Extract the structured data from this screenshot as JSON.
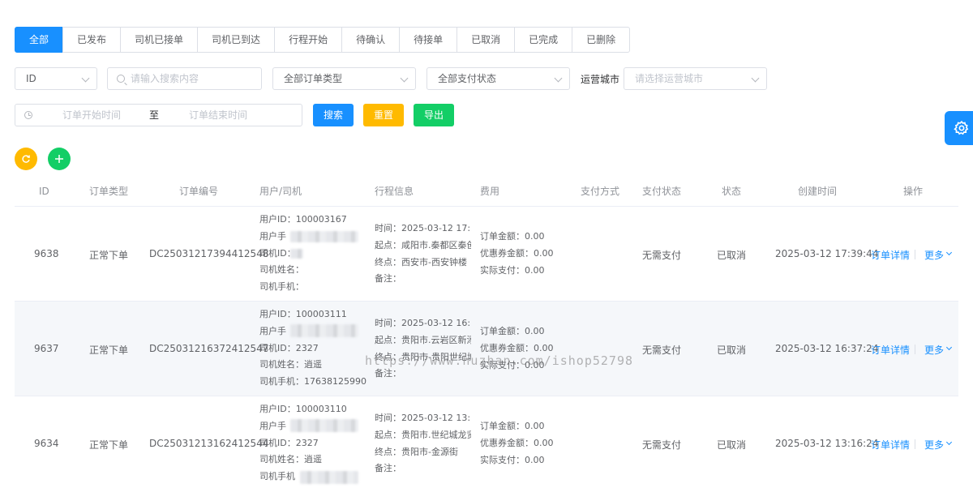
{
  "tabs": [
    {
      "label": "全部",
      "active": true
    },
    {
      "label": "已发布"
    },
    {
      "label": "司机已接单"
    },
    {
      "label": "司机已到达"
    },
    {
      "label": "行程开始"
    },
    {
      "label": "待确认"
    },
    {
      "label": "待接单"
    },
    {
      "label": "已取消"
    },
    {
      "label": "已完成"
    },
    {
      "label": "已删除"
    }
  ],
  "filters": {
    "field_select": "ID",
    "search_placeholder": "请输入搜索内容",
    "order_type_select": "全部订单类型",
    "pay_status_select": "全部支付状态",
    "city_label": "运营城市",
    "city_placeholder": "请选择运营城市",
    "date_start_placeholder": "订单开始时间",
    "date_separator": "至",
    "date_end_placeholder": "订单结束时间",
    "search_button": "搜索",
    "reset_button": "重置",
    "export_button": "导出"
  },
  "colors": {
    "primary": "#1890ff",
    "reset": "#ffba00",
    "export": "#13ce66"
  },
  "table": {
    "headers": [
      "ID",
      "订单类型",
      "订单编号",
      "用户/司机",
      "行程信息",
      "费用",
      "支付方式",
      "支付状态",
      "状态",
      "创建时间",
      "操作"
    ],
    "rows": [
      {
        "id": "9638",
        "type": "正常下单",
        "order_no": "DC25031217394412548",
        "user_id": "用户ID：100003167",
        "user_phone": "用户手",
        "driver_id": "司机ID：",
        "driver_name": "司机姓名：",
        "driver_phone": "司机手机：",
        "trip_time": "时间：2025-03-12 17:39:",
        "trip_start": "起点：咸阳市.秦都区秦创",
        "trip_end": "终点：西安市-西安钟楼",
        "trip_note": "备注：",
        "fee_order": "订单金额：0.00",
        "fee_coupon": "优惠券金额：0.00",
        "fee_paid": "实际支付：0.00",
        "pay_method": "",
        "pay_status": "无需支付",
        "status": "已取消",
        "created": "2025-03-12 17:39:44",
        "action_detail": "订单详情",
        "action_more": "更多"
      },
      {
        "id": "9637",
        "type": "正常下单",
        "order_no": "DC25031216372412547",
        "user_id": "用户ID：100003111",
        "user_phone": "用户手",
        "driver_id": "司机ID：2327",
        "driver_name": "司机姓名：逍遥",
        "driver_phone": "司机手机：17638125990",
        "trip_time": "时间：2025-03-12 16:37:",
        "trip_start": "起点：贵阳市.云岩区新添",
        "trip_end": "终点：贵阳市-贵阳世纪城",
        "trip_note": "备注：",
        "fee_order": "订单金额：0.00",
        "fee_coupon": "优惠券金额：0.00",
        "fee_paid": "实际支付：0.00",
        "pay_method": "",
        "pay_status": "无需支付",
        "status": "已取消",
        "created": "2025-03-12 16:37:24",
        "action_detail": "订单详情",
        "action_more": "更多"
      },
      {
        "id": "9634",
        "type": "正常下单",
        "order_no": "DC25031213162412544",
        "user_id": "用户ID：100003110",
        "user_phone": "用户手",
        "driver_id": "司机ID：2327",
        "driver_name": "司机姓名：逍遥",
        "driver_phone": "司机手机",
        "trip_time": "时间：2025-03-12 13:16:",
        "trip_start": "起点：贵阳市.世纪城龙贤",
        "trip_end": "终点：贵阳市-金源街",
        "trip_note": "备注：",
        "fee_order": "订单金额：0.00",
        "fee_coupon": "优惠券金额：0.00",
        "fee_paid": "实际支付：0.00",
        "pay_method": "",
        "pay_status": "无需支付",
        "status": "已取消",
        "created": "2025-03-12 13:16:24",
        "action_detail": "订单详情",
        "action_more": "更多"
      }
    ]
  },
  "watermark": "https://www.huzhan.com/ishop52798",
  "icons": {
    "refresh": "refresh-icon",
    "add": "plus-icon",
    "settings": "gear-icon"
  }
}
